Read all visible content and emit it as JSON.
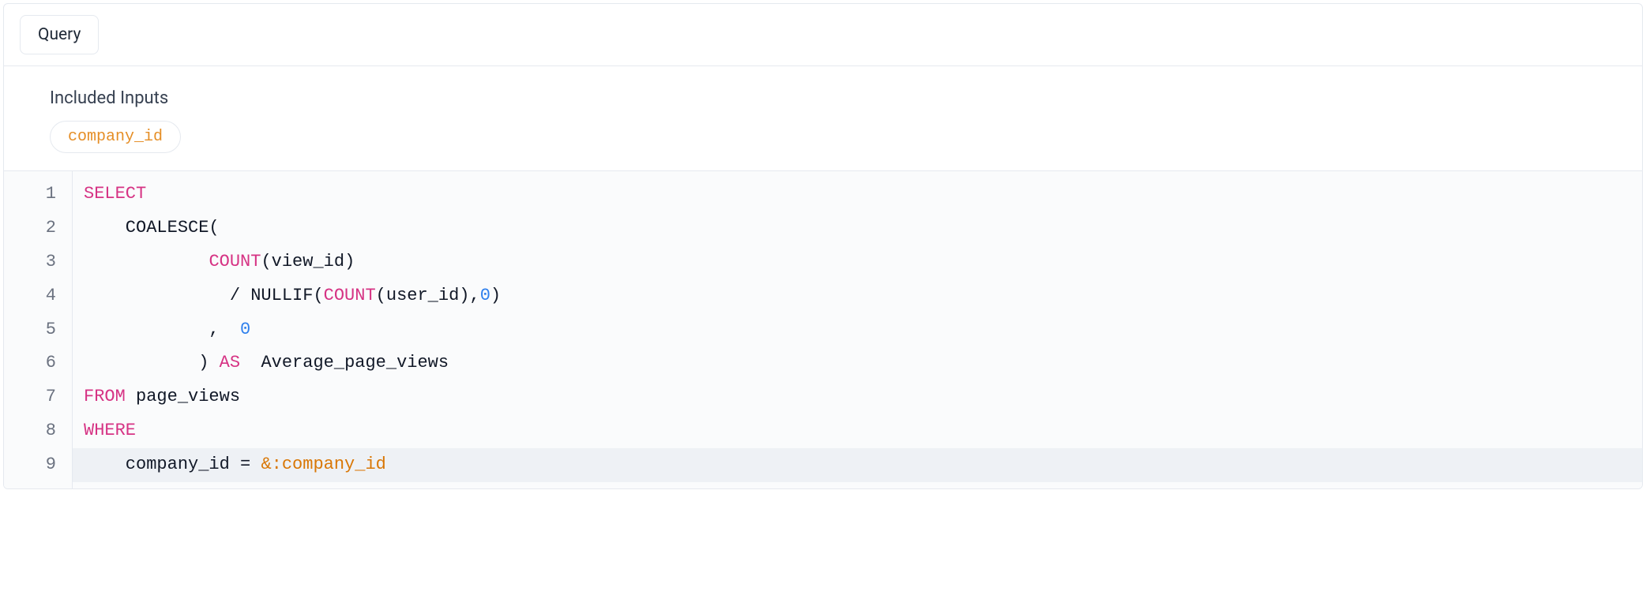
{
  "tabs": {
    "query": "Query"
  },
  "inputs": {
    "title": "Included Inputs",
    "items": [
      "company_id"
    ]
  },
  "editor": {
    "lines": [
      {
        "n": "1",
        "hl": false,
        "tokens": [
          {
            "cls": "tok-keyword",
            "t": "SELECT"
          }
        ]
      },
      {
        "n": "2",
        "hl": false,
        "tokens": [
          {
            "cls": "tok-default",
            "t": "    COALESCE("
          }
        ]
      },
      {
        "n": "3",
        "hl": false,
        "tokens": [
          {
            "cls": "tok-default",
            "t": "            "
          },
          {
            "cls": "tok-func",
            "t": "COUNT"
          },
          {
            "cls": "tok-default",
            "t": "(view_id)"
          }
        ]
      },
      {
        "n": "4",
        "hl": false,
        "tokens": [
          {
            "cls": "tok-default",
            "t": "              / NULLIF("
          },
          {
            "cls": "tok-func",
            "t": "COUNT"
          },
          {
            "cls": "tok-default",
            "t": "(user_id),"
          },
          {
            "cls": "tok-number",
            "t": "0"
          },
          {
            "cls": "tok-default",
            "t": ")"
          }
        ]
      },
      {
        "n": "5",
        "hl": false,
        "tokens": [
          {
            "cls": "tok-default",
            "t": "            ,  "
          },
          {
            "cls": "tok-number",
            "t": "0"
          }
        ]
      },
      {
        "n": "6",
        "hl": false,
        "tokens": [
          {
            "cls": "tok-default",
            "t": "           ) "
          },
          {
            "cls": "tok-keyword",
            "t": "AS"
          },
          {
            "cls": "tok-default",
            "t": "  Average_page_views"
          }
        ]
      },
      {
        "n": "7",
        "hl": false,
        "tokens": [
          {
            "cls": "tok-keyword",
            "t": "FROM"
          },
          {
            "cls": "tok-default",
            "t": " page_views"
          }
        ]
      },
      {
        "n": "8",
        "hl": false,
        "tokens": [
          {
            "cls": "tok-keyword",
            "t": "WHERE"
          }
        ]
      },
      {
        "n": "9",
        "hl": true,
        "tokens": [
          {
            "cls": "tok-default",
            "t": "    company_id = "
          },
          {
            "cls": "tok-param",
            "t": "&:company_id"
          }
        ]
      }
    ]
  }
}
